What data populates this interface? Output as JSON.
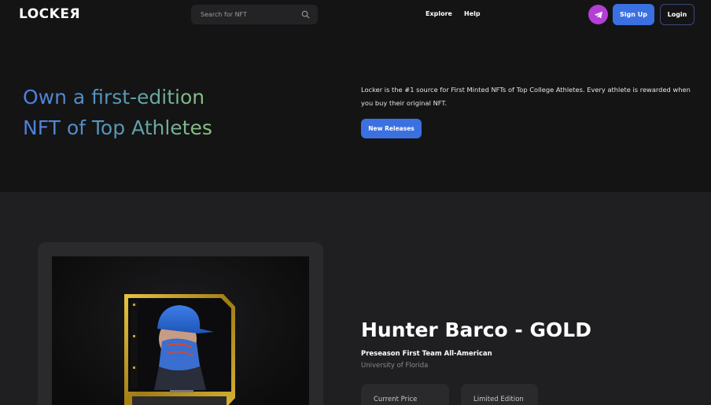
{
  "header": {
    "logo": "LOCKEЯ",
    "search": {
      "placeholder": "Search for NFT",
      "icon": "search-icon"
    },
    "nav": [
      {
        "label": "Explore"
      },
      {
        "label": "Help"
      }
    ],
    "telegram_icon": "telegram-icon",
    "signup_label": "Sign Up",
    "login_label": "Login"
  },
  "hero": {
    "title_line1": "Own a first-edition",
    "title_line2": "NFT of Top Athletes",
    "description": "Locker is the #1 source for First Minted NFTs of Top College Athletes. Every athlete is rewarded when you buy their original NFT.",
    "cta_label": "New Releases"
  },
  "nft": {
    "title": "Hunter Barco - GOLD",
    "subtitle": "Preseason First Team All-American",
    "school": "University of Florida",
    "info": [
      {
        "label": "Current Price"
      },
      {
        "label": "Limited Edition"
      }
    ]
  },
  "colors": {
    "background": "#141415",
    "lower_background": "#1f1f21",
    "accent": "#3b70e0",
    "telegram": "#b53ed6",
    "gold": "#c9a227",
    "gradient_start": "#4d7ee0",
    "gradient_end": "#8ec57a"
  }
}
